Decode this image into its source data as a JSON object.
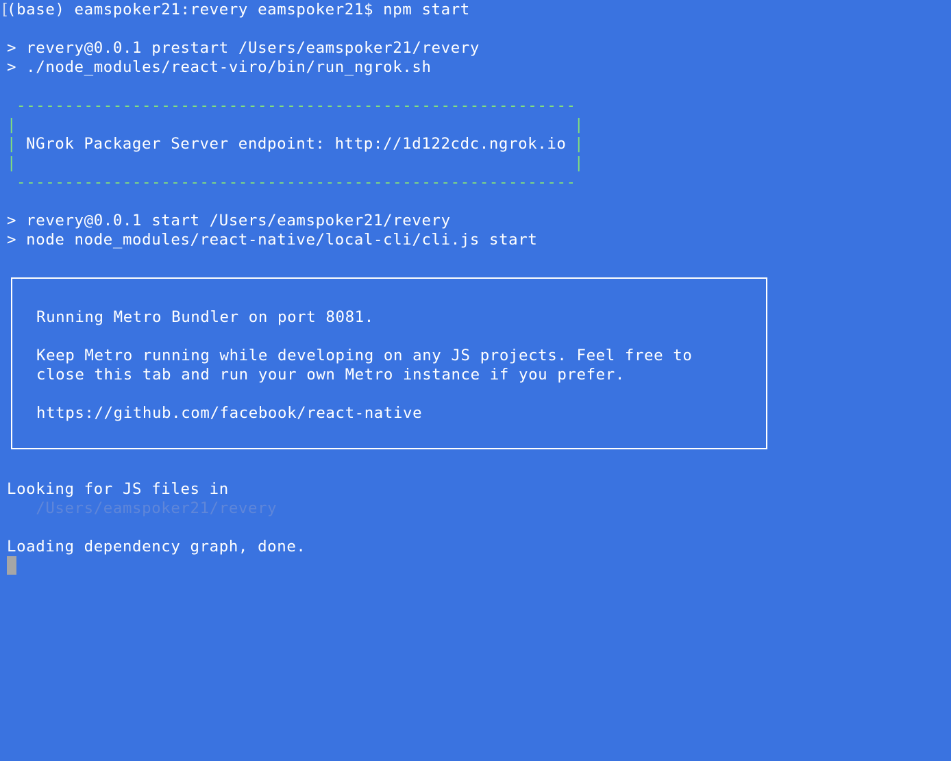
{
  "terminal": {
    "prompt_line": "(base) eamspoker21:revery eamspoker21$ npm start",
    "prompt_bracket": "[",
    "prestart_line": "> revery@0.0.1 prestart /Users/eamspoker21/revery",
    "prestart_cmd": "> ./node_modules/react-viro/bin/run_ngrok.sh",
    "ngrok": {
      "dashes": "----------------------------------------------------------",
      "bar": "|",
      "endpoint_line": "NGrok Packager Server endpoint: http://1d122cdc.ngrok.io"
    },
    "start_line": "> revery@0.0.1 start /Users/eamspoker21/revery",
    "start_cmd": "> node node_modules/react-native/local-cli/cli.js start",
    "metro": {
      "line1": "Running Metro Bundler on port 8081.",
      "line2": "Keep Metro running while developing on any JS projects. Feel free to",
      "line3": "close this tab and run your own Metro instance if you prefer.",
      "line4": "https://github.com/facebook/react-native"
    },
    "looking_line": "Looking for JS files in",
    "looking_path": "   /Users/eamspoker21/revery",
    "loading_line": "Loading dependency graph, done."
  },
  "colors": {
    "background": "#3a73e0",
    "text": "#ffffff",
    "ngrok_border": "#84e07a",
    "dim_path": "#5f86d9",
    "cursor": "#a6a6a6"
  }
}
